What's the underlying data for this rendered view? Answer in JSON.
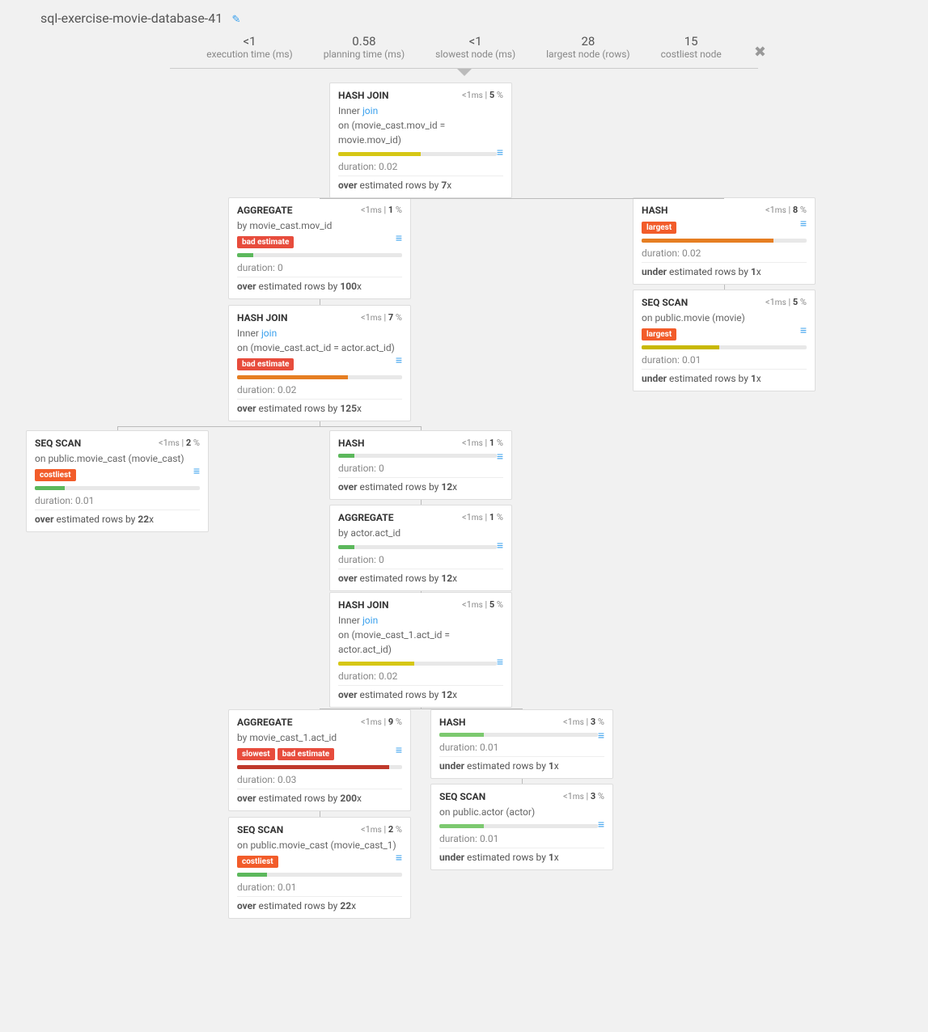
{
  "page_title": "sql-exercise-movie-database-41",
  "stats": [
    {
      "value": "<1",
      "label": "execution time (ms)"
    },
    {
      "value": "0.58",
      "label": "planning time (ms)"
    },
    {
      "value": "<1",
      "label": "slowest node (ms)"
    },
    {
      "value": "28",
      "label": "largest node (rows)"
    },
    {
      "value": "15",
      "label": "costliest node"
    }
  ],
  "nodes": {
    "n0": {
      "title": "HASH JOIN",
      "ms": "<1",
      "pct": "5",
      "l1a": "Inner ",
      "l1b": "join",
      "l2": "on (movie_cast.mov_id = movie.mov_id)",
      "bar_w": "52%",
      "bar_c": "f-yellow",
      "dur": "duration: 0.02",
      "est1": "over",
      "est2": " estimated rows by ",
      "est3": "7",
      "est4": "x"
    },
    "n1": {
      "title": "AGGREGATE",
      "ms": "<1",
      "pct": "1",
      "l2": "by movie_cast.mov_id",
      "badges": [
        "bad estimate"
      ],
      "bar_w": "10%",
      "bar_c": "f-green",
      "dur": "duration: 0",
      "est1": "over",
      "est2": " estimated rows by ",
      "est3": "100",
      "est4": "x"
    },
    "n2": {
      "title": "HASH",
      "ms": "<1",
      "pct": "8",
      "badges": [
        "largest"
      ],
      "badge_c": "badge-orange",
      "bar_w": "80%",
      "bar_c": "f-orange",
      "dur": "duration: 0.02",
      "est1": "under",
      "est2": " estimated rows by ",
      "est3": "1",
      "est4": "x"
    },
    "n3": {
      "title": "SEQ SCAN",
      "ms": "<1",
      "pct": "5",
      "l2": "on public.movie (movie)",
      "badges": [
        "largest"
      ],
      "badge_c": "badge-orange",
      "bar_w": "47%",
      "bar_c": "f-dyellow",
      "dur": "duration: 0.01",
      "est1": "under",
      "est2": " estimated rows by ",
      "est3": "1",
      "est4": "x"
    },
    "n4": {
      "title": "HASH JOIN",
      "ms": "<1",
      "pct": "7",
      "l1a": "Inner ",
      "l1b": "join",
      "l2": "on (movie_cast.act_id = actor.act_id)",
      "badges": [
        "bad estimate"
      ],
      "bar_w": "67%",
      "bar_c": "f-orange",
      "dur": "duration: 0.02",
      "est1": "over",
      "est2": " estimated rows by ",
      "est3": "125",
      "est4": "x"
    },
    "n5": {
      "title": "SEQ SCAN",
      "ms": "<1",
      "pct": "2",
      "l2": "on public.movie_cast (movie_cast)",
      "badges": [
        "costliest"
      ],
      "badge_c": "badge-orange",
      "bar_w": "18%",
      "bar_c": "f-green",
      "dur": "duration: 0.01",
      "est1": "over",
      "est2": " estimated rows by ",
      "est3": "22",
      "est4": "x"
    },
    "n6": {
      "title": "HASH",
      "ms": "<1",
      "pct": "1",
      "bar_w": "10%",
      "bar_c": "f-green",
      "dur": "duration: 0",
      "est1": "over",
      "est2": " estimated rows by ",
      "est3": "12",
      "est4": "x"
    },
    "n7": {
      "title": "AGGREGATE",
      "ms": "<1",
      "pct": "1",
      "l2": "by actor.act_id",
      "bar_w": "10%",
      "bar_c": "f-green",
      "dur": "duration: 0",
      "est1": "over",
      "est2": " estimated rows by ",
      "est3": "12",
      "est4": "x"
    },
    "n8": {
      "title": "HASH JOIN",
      "ms": "<1",
      "pct": "5",
      "l1a": "Inner ",
      "l1b": "join",
      "l2": "on (movie_cast_1.act_id = actor.act_id)",
      "bar_w": "48%",
      "bar_c": "f-yellow",
      "dur": "duration: 0.02",
      "est1": "over",
      "est2": " estimated rows by ",
      "est3": "12",
      "est4": "x"
    },
    "n9": {
      "title": "AGGREGATE",
      "ms": "<1",
      "pct": "9",
      "l2": "by movie_cast_1.act_id",
      "badges": [
        "slowest",
        "bad estimate"
      ],
      "bar_w": "92%",
      "bar_c": "f-red",
      "dur": "duration: 0.03",
      "est1": "over",
      "est2": " estimated rows by ",
      "est3": "200",
      "est4": "x"
    },
    "n10": {
      "title": "HASH",
      "ms": "<1",
      "pct": "3",
      "bar_w": "28%",
      "bar_c": "f-lgreen",
      "dur": "duration: 0.01",
      "est1": "under",
      "est2": " estimated rows by ",
      "est3": "1",
      "est4": "x"
    },
    "n11": {
      "title": "SEQ SCAN",
      "ms": "<1",
      "pct": "3",
      "l2": "on public.actor (actor)",
      "bar_w": "28%",
      "bar_c": "f-lgreen",
      "dur": "duration: 0.01",
      "est1": "under",
      "est2": " estimated rows by ",
      "est3": "1",
      "est4": "x"
    },
    "n12": {
      "title": "SEQ SCAN",
      "ms": "<1",
      "pct": "2",
      "l2": "on public.movie_cast (movie_cast_1)",
      "badges": [
        "costliest"
      ],
      "badge_c": "badge-orange",
      "bar_w": "18%",
      "bar_c": "f-green",
      "dur": "duration: 0.01",
      "est1": "over",
      "est2": " estimated rows by ",
      "est3": "22",
      "est4": "x"
    }
  }
}
